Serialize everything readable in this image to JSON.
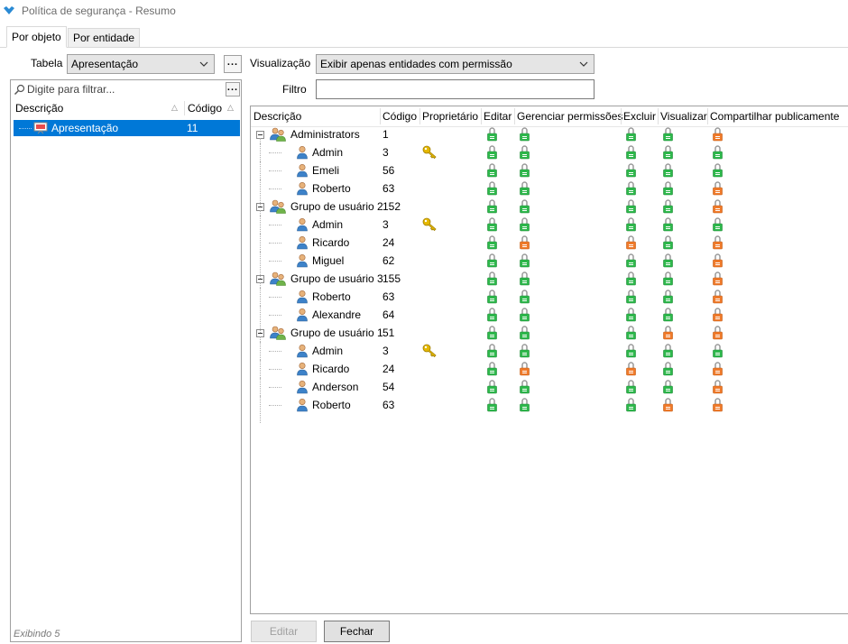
{
  "window": {
    "title": "Política de segurança - Resumo"
  },
  "tabs": [
    {
      "label": "Por objeto",
      "active": true
    },
    {
      "label": "Por entidade",
      "active": false
    }
  ],
  "left": {
    "table_label": "Tabela",
    "table_value": "Apresentação",
    "filter_placeholder": "Digite para filtrar...",
    "col_desc": "Descrição",
    "col_code": "Código",
    "rows": [
      {
        "desc": "Apresentação",
        "code": "11"
      }
    ],
    "status": "Exibindo 5"
  },
  "right": {
    "view_label": "Visualização",
    "view_value": "Exibir apenas entidades com permissão",
    "filter_label": "Filtro",
    "filter_value": "",
    "columns": [
      "Descrição",
      "Código",
      "Proprietário",
      "Editar",
      "Gerenciar permissões",
      "Excluir",
      "Visualizar",
      "Compartilhar publicamente"
    ],
    "rows": [
      {
        "kind": "group",
        "desc": "Administrators",
        "code": "1",
        "owner": false,
        "perms": [
          "g",
          "g",
          "g",
          "g",
          "o"
        ]
      },
      {
        "kind": "user",
        "desc": "Admin",
        "code": "3",
        "owner": true,
        "perms": [
          "g",
          "g",
          "g",
          "g",
          "g"
        ]
      },
      {
        "kind": "user",
        "desc": "Emeli",
        "code": "56",
        "owner": false,
        "perms": [
          "g",
          "g",
          "g",
          "g",
          "g"
        ]
      },
      {
        "kind": "user",
        "desc": "Roberto",
        "code": "63",
        "owner": false,
        "perms": [
          "g",
          "g",
          "g",
          "g",
          "o"
        ]
      },
      {
        "kind": "group",
        "desc": "Grupo de usuário 2",
        "code": "152",
        "owner": false,
        "perms": [
          "g",
          "g",
          "g",
          "g",
          "o"
        ]
      },
      {
        "kind": "user",
        "desc": "Admin",
        "code": "3",
        "owner": true,
        "perms": [
          "g",
          "g",
          "g",
          "g",
          "g"
        ]
      },
      {
        "kind": "user",
        "desc": "Ricardo",
        "code": "24",
        "owner": false,
        "perms": [
          "g",
          "o",
          "o",
          "g",
          "o"
        ]
      },
      {
        "kind": "user",
        "desc": "Miguel",
        "code": "62",
        "owner": false,
        "perms": [
          "g",
          "g",
          "g",
          "g",
          "o"
        ]
      },
      {
        "kind": "group",
        "desc": "Grupo de usuário 3",
        "code": "155",
        "owner": false,
        "perms": [
          "g",
          "g",
          "g",
          "g",
          "o"
        ]
      },
      {
        "kind": "user",
        "desc": "Roberto",
        "code": "63",
        "owner": false,
        "perms": [
          "g",
          "g",
          "g",
          "g",
          "o"
        ]
      },
      {
        "kind": "user",
        "desc": "Alexandre",
        "code": "64",
        "owner": false,
        "perms": [
          "g",
          "g",
          "g",
          "g",
          "o"
        ]
      },
      {
        "kind": "group",
        "desc": "Grupo de usuário 1",
        "code": "51",
        "owner": false,
        "perms": [
          "g",
          "g",
          "g",
          "o",
          "o"
        ]
      },
      {
        "kind": "user",
        "desc": "Admin",
        "code": "3",
        "owner": true,
        "perms": [
          "g",
          "g",
          "g",
          "g",
          "g"
        ]
      },
      {
        "kind": "user",
        "desc": "Ricardo",
        "code": "24",
        "owner": false,
        "perms": [
          "g",
          "o",
          "o",
          "g",
          "o"
        ]
      },
      {
        "kind": "user",
        "desc": "Anderson",
        "code": "54",
        "owner": false,
        "perms": [
          "g",
          "g",
          "g",
          "g",
          "o"
        ]
      },
      {
        "kind": "user",
        "desc": "Roberto",
        "code": "63",
        "owner": false,
        "perms": [
          "g",
          "g",
          "g",
          "o",
          "o"
        ]
      }
    ]
  },
  "buttons": {
    "edit": "Editar",
    "close": "Fechar"
  },
  "colors": {
    "selection": "#0078d7",
    "lock_green": "#2db84b",
    "lock_orange": "#f07a2a",
    "key": "#e5b800"
  },
  "icons": [
    "app-icon",
    "search-icon",
    "chevron-down-icon",
    "presentation-icon",
    "group-icon",
    "user-icon",
    "key-icon",
    "lock-icon",
    "collapse-icon"
  ]
}
